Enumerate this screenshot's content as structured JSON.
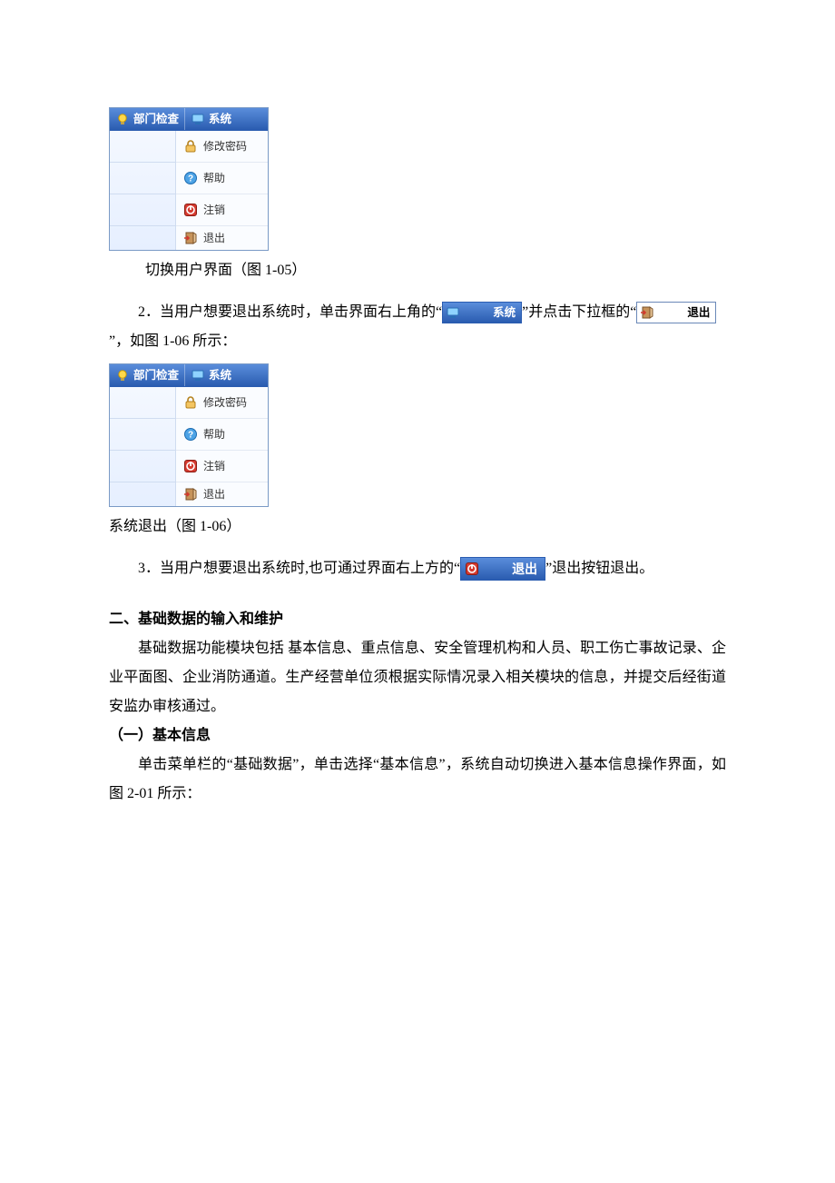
{
  "menu": {
    "tab_inspect": "部门检查",
    "tab_system": "系统",
    "items": {
      "change_pwd": "修改密码",
      "help": "帮助",
      "logout": "注销",
      "exit": "退出"
    }
  },
  "chips": {
    "system": "系统",
    "exit": "退出",
    "exit_big": "退出"
  },
  "captions": {
    "fig105": "切换用户界面（图 1-05）",
    "fig106": "系统退出（图 1-06）"
  },
  "paragraphs": {
    "p2a": "2．当用户想要退出系统时，单击界面右上角的“",
    "p2b": "”并点击下拉框的“",
    "p2c": "”，如图 1-06 所示：",
    "p3a": "3．当用户想要退出系统时,也可通过界面右上方的“",
    "p3b": "”退出按钮退出。",
    "h2": "二、基础数据的输入和维护",
    "intro": "基础数据功能模块包括 基本信息、重点信息、安全管理机构和人员、职工伤亡事故记录、企业平面图、企业消防通道。生产经营单位须根据实际情况录入相关模块的信息，并提交后经街道安监办审核通过。",
    "sub1": "（一）基本信息",
    "sub1_body": "单击菜单栏的“基础数据”，单击选择“基本信息”，系统自动切换进入基本信息操作界面，如图 2-01 所示："
  }
}
